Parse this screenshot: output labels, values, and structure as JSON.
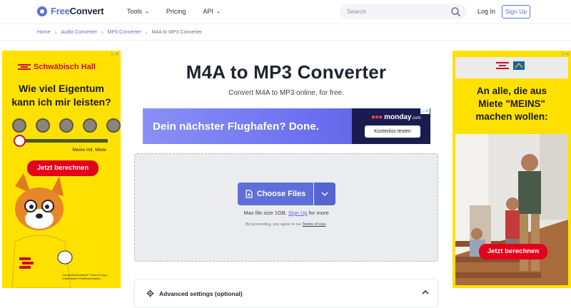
{
  "header": {
    "logo_free": "Free",
    "logo_convert": "Convert",
    "nav": [
      {
        "label": "Tools",
        "has_dropdown": true
      },
      {
        "label": "Pricing",
        "has_dropdown": false
      },
      {
        "label": "API",
        "has_dropdown": true
      }
    ],
    "search_placeholder": "Search",
    "login_label": "Log In",
    "signup_label": "Sign Up"
  },
  "breadcrumb": {
    "items": [
      "Home",
      "Audio Converter",
      "MP3 Converter"
    ],
    "current": "M4A to MP3 Converter"
  },
  "main": {
    "title": "M4A to MP3 Converter",
    "subtitle": "Convert M4A to MP3 online, for free.",
    "choose_files_label": "Choose Files",
    "max_size_prefix": "Max file size 1GB.",
    "max_size_link": "Sign Up",
    "max_size_suffix": "for more",
    "terms_prefix": "By proceeding, you agree to our",
    "terms_link": "Terms of Use",
    "terms_suffix": ".",
    "advanced_label": "Advanced settings (optional)"
  },
  "banner_ad": {
    "text": "Dein nächster Flughafen? Done.",
    "brand": "monday",
    "brand_suffix": ".com",
    "button": "Kostenlos testen"
  },
  "ad_left": {
    "brand": "Schwäbisch Hall",
    "headline_1": "Wie viel Eigentum",
    "headline_2": "kann ich mir leisten?",
    "slider_label": "Meine mtl. Miete",
    "button": "Jetzt berechnen",
    "footer": "Genossenschaftliche FinanzGruppe Volksbanken Raiffeisenbanken"
  },
  "ad_right": {
    "headline_1": "An alle, die aus",
    "headline_2": "Miete \"MEINS\"",
    "headline_3": "machen wollen:",
    "button": "Jetzt berechnen"
  },
  "colors": {
    "brand": "#5f6fd9",
    "ad_yellow": "#ffe100",
    "ad_red": "#e3001b",
    "banner_purple": "#6b6ff0",
    "dropzone_bg": "#ebecf0"
  },
  "icons": [
    "logo-icon",
    "search-icon",
    "chevron-down-icon",
    "file-icon",
    "gear-icon",
    "chevron-up-icon",
    "ad-choices-icon"
  ]
}
